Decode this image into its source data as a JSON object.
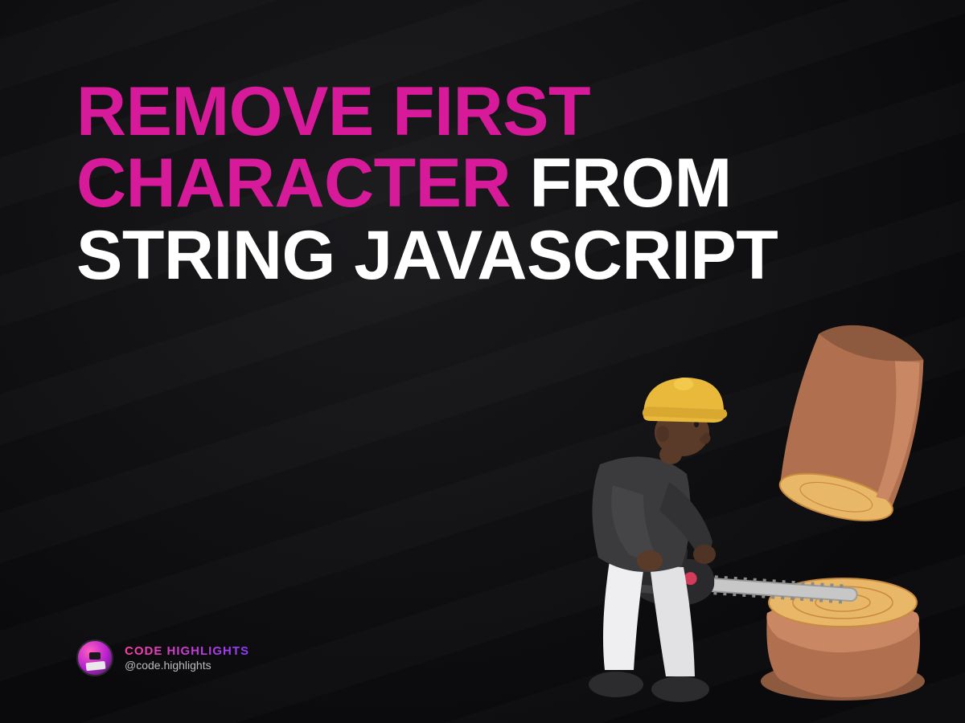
{
  "title": {
    "accent": "REMOVE FIRST CHARACTER",
    "plain": " FROM STRING JAVASCRIPT"
  },
  "attribution": {
    "brand": "CODE HIGHLIGHTS",
    "handle": "@code.highlights"
  },
  "illustration": {
    "name": "worker-sawing-log",
    "palette": {
      "helmet": "#e9b93c",
      "skin": "#5a3a29",
      "shirt": "#3b3b3d",
      "pants": "#efeef0",
      "shoes": "#2c2c2e",
      "log": "#b0704f",
      "log_light": "#c98863",
      "log_cut": "#e9b768",
      "blade": "#c7c7c7",
      "saw_body": "#2a2a2c"
    }
  },
  "colors": {
    "background": "#0e0e10",
    "accent_text": "#d61a9a",
    "plain_text": "#ffffff"
  }
}
